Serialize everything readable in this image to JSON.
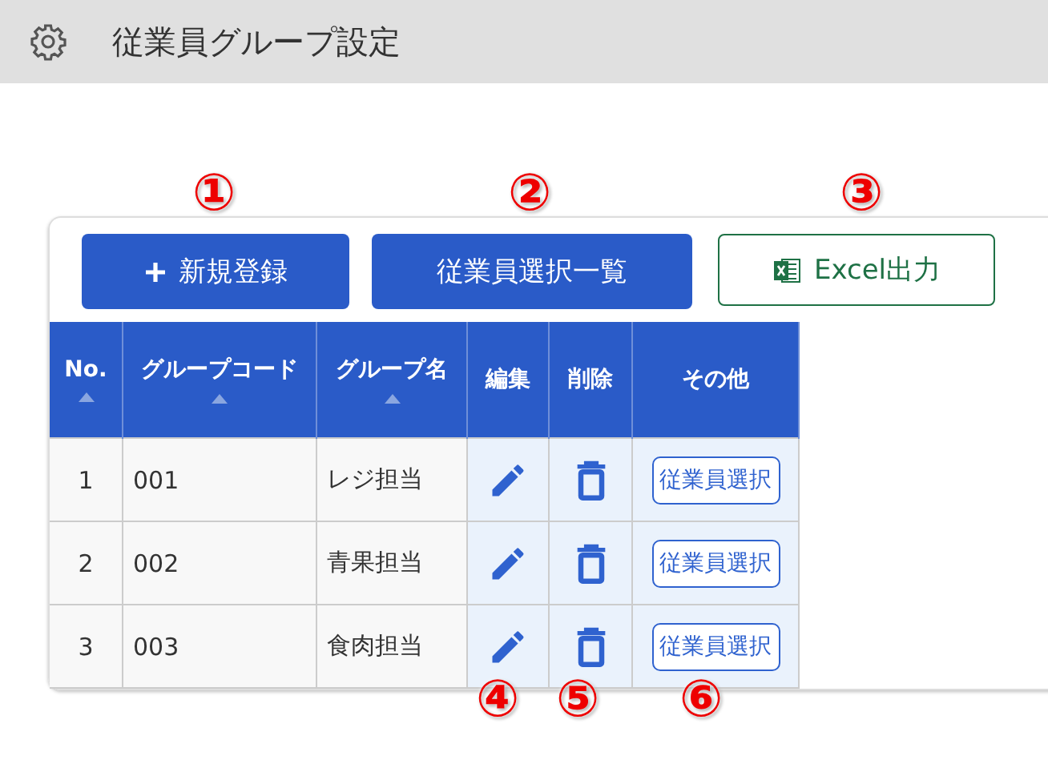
{
  "header": {
    "title": "従業員グループ設定"
  },
  "toolbar": [
    {
      "kind": "add",
      "label": "新規登録"
    },
    {
      "kind": "primary",
      "label": "従業員選択一覧"
    },
    {
      "kind": "excel",
      "label": "Excel出力"
    }
  ],
  "table": {
    "columns": [
      {
        "label": "No.",
        "sortable": true
      },
      {
        "label": "グループコード",
        "sortable": true
      },
      {
        "label": "グループ名",
        "sortable": true
      },
      {
        "label": "編集",
        "sortable": false
      },
      {
        "label": "削除",
        "sortable": false
      },
      {
        "label": "その他",
        "sortable": false
      }
    ],
    "rows": [
      {
        "no": "1",
        "code": "001",
        "name": "レジ担当",
        "action": "従業員選択"
      },
      {
        "no": "2",
        "code": "002",
        "name": "青果担当",
        "action": "従業員選択"
      },
      {
        "no": "3",
        "code": "003",
        "name": "食肉担当",
        "action": "従業員選択"
      }
    ]
  },
  "annotations": [
    "①",
    "②",
    "③",
    "④",
    "⑤",
    "⑥"
  ]
}
